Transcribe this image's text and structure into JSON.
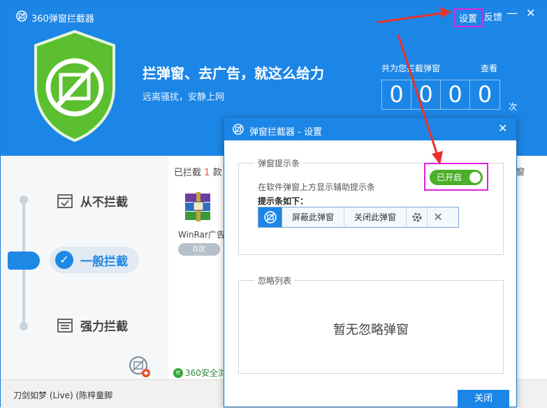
{
  "app": {
    "title": "360弹窗拦截器",
    "settings_label": "设置",
    "feedback_label": "反馈",
    "minimize_glyph": "—",
    "close_glyph": "✕"
  },
  "header": {
    "slogan": "拦弹窗、去广告，就这么给力",
    "subslogan": "远离骚扰，安静上网",
    "total_label": "共为您拦截弹窗",
    "view_label": "查看",
    "digits": [
      "0",
      "0",
      "0",
      "0"
    ],
    "unit": "次",
    "shield_color": "#5bbf2f"
  },
  "modes": {
    "never": "从不拦截",
    "normal": "一般拦截",
    "strong": "强力拦截",
    "active_check": "✓"
  },
  "content": {
    "blocked_prefix": "已拦截",
    "blocked_count": "1",
    "blocked_suffix": "款",
    "app_name": "WinRar广告",
    "count_pill": "0次",
    "footer_link": "360安全浏",
    "footer_icon": "e",
    "right_edge": "窗",
    "song": "刀剑如梦 (Live) (陈梓童脚"
  },
  "dialog": {
    "title": "弹窗拦截器 - 设置",
    "close_glyph": "✕",
    "group1_legend": "弹窗提示条",
    "group1_desc": "在软件弹窗上方显示辅助提示条",
    "toggle_label": "已开启",
    "bar_label": "提示条如下：",
    "block_btn": "屏蔽此弹窗",
    "close_popup_btn": "关闭此弹窗",
    "bar_close_glyph": "✕",
    "group2_legend": "忽略列表",
    "empty_text": "暂无忽略弹窗",
    "close_button": "关闭"
  },
  "colors": {
    "brand_blue": "#1c86e6",
    "highlight": "#e020e0",
    "toggle_on": "#4caf29",
    "arrow": "#e8322d"
  }
}
